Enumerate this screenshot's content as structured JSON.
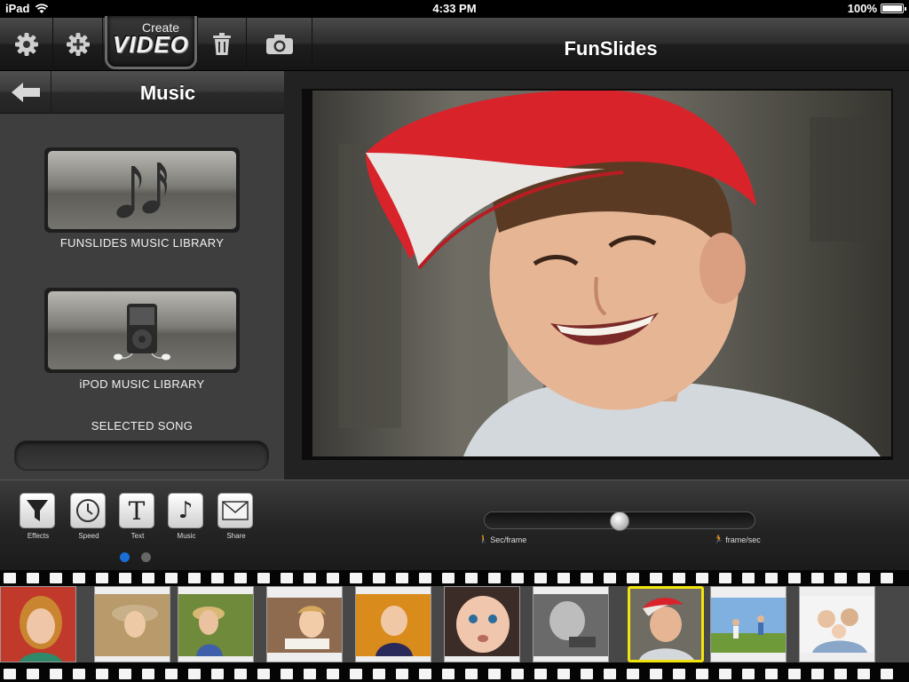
{
  "status_bar": {
    "device": "iPad",
    "time": "4:33 PM",
    "battery": "100%"
  },
  "toolbar": {
    "create_small": "Create",
    "create_big": "VIDEO",
    "title": "FunSlides",
    "buttons": [
      "gear-icon",
      "add-icon",
      "create-video-button",
      "trash-icon",
      "camera-icon"
    ]
  },
  "music_panel": {
    "title": "Music",
    "funslides_library_label": "FUNSLIDES MUSIC LIBRARY",
    "ipod_library_label": "iPOD MUSIC LIBRARY",
    "selected_song_label": "SELECTED SONG",
    "selected_song_value": ""
  },
  "tools": [
    {
      "label": "Effects",
      "icon": "funnel-icon"
    },
    {
      "label": "Speed",
      "icon": "clock-icon"
    },
    {
      "label": "Text",
      "icon": "text-icon"
    },
    {
      "label": "Music",
      "icon": "music-note-icon"
    },
    {
      "label": "Share",
      "icon": "envelope-icon"
    }
  ],
  "page_indicator": {
    "pages": 2,
    "current": 1
  },
  "speed_slider": {
    "left_label": "Sec/frame",
    "right_label": "frame/sec",
    "value": 0.5
  },
  "filmstrip": {
    "count": 10,
    "selected_index": 7
  },
  "colors": {
    "accent_blue": "#1a6fd6",
    "selection_yellow": "#f1e40c",
    "cap_red": "#d9232b"
  }
}
